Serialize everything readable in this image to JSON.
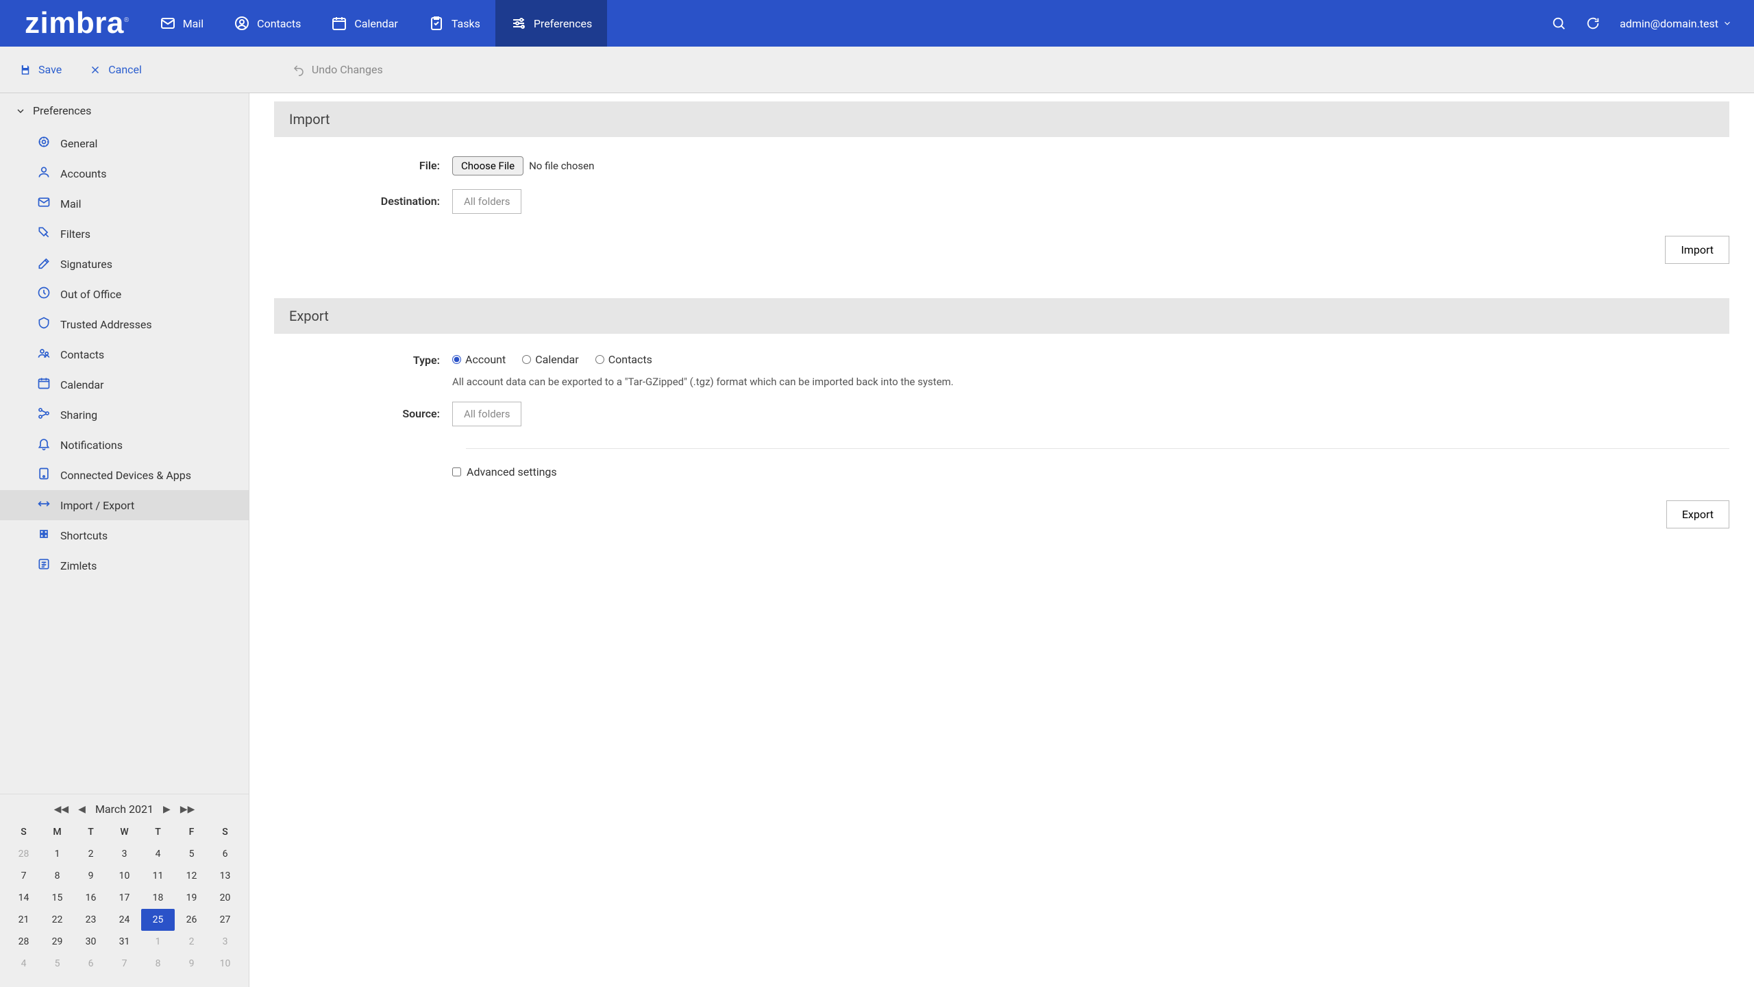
{
  "logo": "zimbra",
  "nav": {
    "mail": "Mail",
    "contacts": "Contacts",
    "calendar": "Calendar",
    "tasks": "Tasks",
    "preferences": "Preferences",
    "user": "admin@domain.test"
  },
  "toolbar": {
    "save": "Save",
    "cancel": "Cancel",
    "undo": "Undo Changes"
  },
  "sidebar": {
    "heading": "Preferences",
    "items": [
      "General",
      "Accounts",
      "Mail",
      "Filters",
      "Signatures",
      "Out of Office",
      "Trusted Addresses",
      "Contacts",
      "Calendar",
      "Sharing",
      "Notifications",
      "Connected Devices & Apps",
      "Import / Export",
      "Shortcuts",
      "Zimlets"
    ],
    "active_index": 12
  },
  "minical": {
    "title": "March 2021",
    "dow": [
      "S",
      "M",
      "T",
      "W",
      "T",
      "F",
      "S"
    ],
    "weeks": [
      [
        {
          "d": "28",
          "o": true
        },
        {
          "d": "1"
        },
        {
          "d": "2"
        },
        {
          "d": "3"
        },
        {
          "d": "4"
        },
        {
          "d": "5"
        },
        {
          "d": "6"
        }
      ],
      [
        {
          "d": "7"
        },
        {
          "d": "8"
        },
        {
          "d": "9"
        },
        {
          "d": "10"
        },
        {
          "d": "11"
        },
        {
          "d": "12"
        },
        {
          "d": "13"
        }
      ],
      [
        {
          "d": "14"
        },
        {
          "d": "15"
        },
        {
          "d": "16"
        },
        {
          "d": "17"
        },
        {
          "d": "18"
        },
        {
          "d": "19"
        },
        {
          "d": "20"
        }
      ],
      [
        {
          "d": "21"
        },
        {
          "d": "22"
        },
        {
          "d": "23"
        },
        {
          "d": "24"
        },
        {
          "d": "25",
          "t": true
        },
        {
          "d": "26"
        },
        {
          "d": "27"
        }
      ],
      [
        {
          "d": "28"
        },
        {
          "d": "29"
        },
        {
          "d": "30"
        },
        {
          "d": "31"
        },
        {
          "d": "1",
          "o": true
        },
        {
          "d": "2",
          "o": true
        },
        {
          "d": "3",
          "o": true
        }
      ],
      [
        {
          "d": "4",
          "o": true
        },
        {
          "d": "5",
          "o": true
        },
        {
          "d": "6",
          "o": true
        },
        {
          "d": "7",
          "o": true
        },
        {
          "d": "8",
          "o": true
        },
        {
          "d": "9",
          "o": true
        },
        {
          "d": "10",
          "o": true
        }
      ]
    ]
  },
  "import": {
    "heading": "Import",
    "file_label": "File:",
    "file_button": "Choose File",
    "file_placeholder": "No file chosen",
    "dest_label": "Destination:",
    "dest_value": "All folders",
    "action": "Import"
  },
  "export": {
    "heading": "Export",
    "type_label": "Type:",
    "type_options": [
      "Account",
      "Calendar",
      "Contacts"
    ],
    "type_selected": 0,
    "type_note": "All account data can be exported to a \"Tar-GZipped\" (.tgz) format which can be imported back into the system.",
    "source_label": "Source:",
    "source_value": "All folders",
    "advanced_label": "Advanced settings",
    "action": "Export"
  }
}
